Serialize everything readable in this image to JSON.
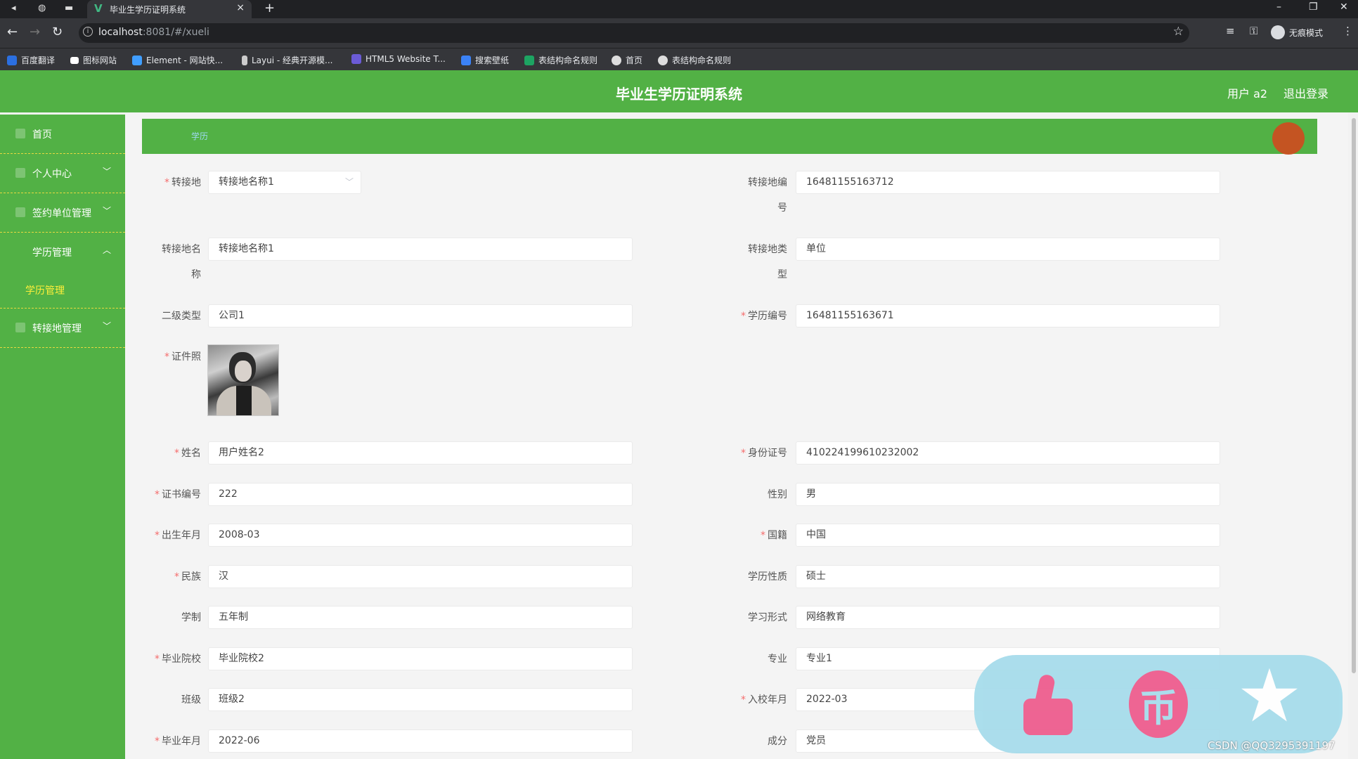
{
  "browser": {
    "tab_title": "毕业生学历证明系统",
    "url_host": "localhost",
    "url_rest": ":8081/#/xueli",
    "incognito_label": "无痕模式",
    "bookmarks": [
      {
        "label": "百度翻译",
        "color": "#2b6fe0"
      },
      {
        "label": "图标网站",
        "color": "#ffffff"
      },
      {
        "label": "Element - 网站快...",
        "color": "#409eff"
      },
      {
        "label": "Layui - 经典开源模...",
        "color": "#cccccc"
      },
      {
        "label": "HTML5 Website T...",
        "color": "#6b5bd6"
      },
      {
        "label": "搜索壁纸",
        "color": "#3b82f6"
      },
      {
        "label": "表结构命名规则",
        "color": "#1da462"
      },
      {
        "label": "首页",
        "color": "#dddddd"
      },
      {
        "label": "表结构命名规则",
        "color": "#dddddd"
      }
    ]
  },
  "header": {
    "title": "毕业生学历证明系统",
    "user": "用户 a2",
    "logout": "退出登录"
  },
  "sidebar": {
    "items": [
      {
        "label": "首页"
      },
      {
        "label": "个人中心"
      },
      {
        "label": "签约单位管理"
      },
      {
        "label": "学历管理"
      },
      {
        "label": "学历管理"
      },
      {
        "label": "转接地管理"
      }
    ]
  },
  "breadcrumb": {
    "text": "学历"
  },
  "form": {
    "zhuanjiedi": {
      "label": "转接地",
      "value": "转接地名称1"
    },
    "zhuanjiedi_bianhao": {
      "label_a": "转接地编",
      "label_b": "号",
      "value": "1648115516371​2"
    },
    "zhuanjiedi_mingcheng": {
      "label_a": "转接地名",
      "label_b": "称",
      "value": "转接地名称1"
    },
    "zhuanjiedi_leixing": {
      "label_a": "转接地类",
      "label_b": "型",
      "value": "单位"
    },
    "erji_leixing": {
      "label": "二级类型",
      "value": "公司1"
    },
    "xueli_bianhao": {
      "label": "学历编号",
      "value": "16481155163671"
    },
    "zhengjianzhao": {
      "label": "证件照"
    },
    "xingming": {
      "label": "姓名",
      "value": "用户姓名2"
    },
    "shenfenzheng": {
      "label": "身份证号",
      "value": "410224199610232002"
    },
    "zhengshu_bianhao": {
      "label": "证书编号",
      "value": "222"
    },
    "xingbie": {
      "label": "性别",
      "value": "男"
    },
    "chusheng": {
      "label": "出生年月",
      "value": "2008-03"
    },
    "guoji": {
      "label": "国籍",
      "value": "中国"
    },
    "minzu": {
      "label": "民族",
      "value": "汉"
    },
    "xueli_xingzhi": {
      "label": "学历性质",
      "value": "硕士"
    },
    "xuezhi": {
      "label": "学制",
      "value": "五年制"
    },
    "xuexi_xingshi": {
      "label": "学习形式",
      "value": "网络教育"
    },
    "biye_yuanxiao": {
      "label": "毕业院校",
      "value": "毕业院校2"
    },
    "zhuanye": {
      "label": "专业",
      "value": "专业1"
    },
    "banji": {
      "label": "班级",
      "value": "班级2"
    },
    "ruxiao": {
      "label": "入校年月",
      "value": "2022-03"
    },
    "biye_nianyue": {
      "label": "毕业年月",
      "value": "2022-06"
    },
    "chengfen": {
      "label": "成分",
      "value": "党员"
    }
  },
  "overlay": {
    "coin_glyph": "币",
    "watermark": "CSDN @QQ3295391197"
  },
  "colors": {
    "brand_green": "#52b145",
    "menu_active": "#ffef3a",
    "required": "#f56c6c",
    "overlay_bg": "#a7dceb",
    "overlay_icon": "#ee5d8e"
  }
}
